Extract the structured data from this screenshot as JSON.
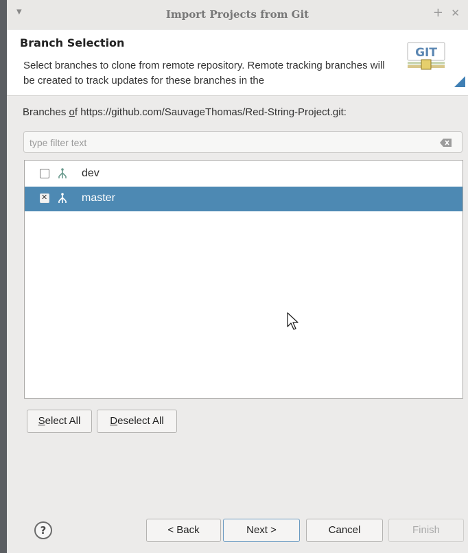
{
  "window": {
    "title": "Import Projects from Git"
  },
  "header": {
    "title": "Branch Selection",
    "description": "Select branches to clone from remote repository. Remote tracking branches will be created to track updates for these branches in the",
    "logo_text": "GIT"
  },
  "branches": {
    "label_prefix": "Branches ",
    "label_mnemonic": "o",
    "label_suffix": "f https://github.com/SauvageThomas/Red-String-Project.git:",
    "filter_placeholder": "type filter text",
    "items": [
      {
        "name": "dev",
        "checked": false,
        "selected": false
      },
      {
        "name": "master",
        "checked": true,
        "selected": true
      }
    ]
  },
  "selection_buttons": {
    "select_all_mnemonic": "S",
    "select_all_rest": "elect All",
    "deselect_all_mnemonic": "D",
    "deselect_all_rest": "eselect All"
  },
  "footer": {
    "help": "?",
    "back": "< Back",
    "next": "Next >",
    "cancel": "Cancel",
    "finish": "Finish"
  },
  "colors": {
    "selection": "#4d89b3",
    "dialog_bg": "#ecebea",
    "header_bg": "#ffffff"
  }
}
